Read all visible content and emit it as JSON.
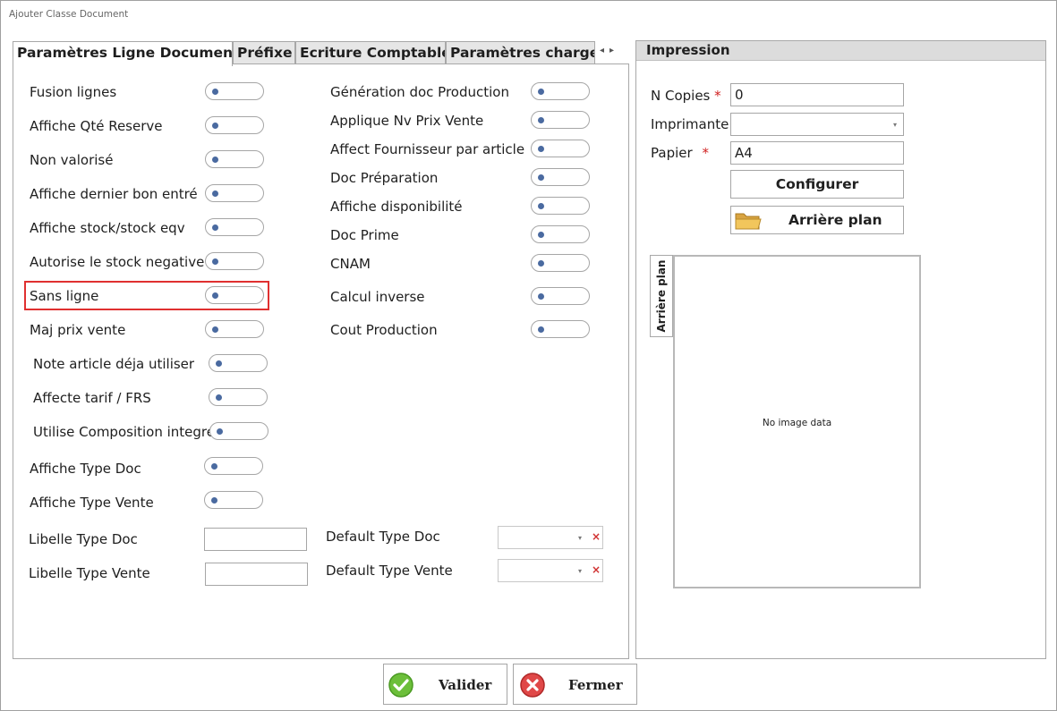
{
  "window": {
    "title": "Ajouter Classe Document"
  },
  "tabs": [
    {
      "label": "Paramètres Ligne Document"
    },
    {
      "label": "Préfixe"
    },
    {
      "label": "Ecriture Comptable"
    },
    {
      "label": "Paramètres charge"
    }
  ],
  "tab_nav": {
    "prev": "◂",
    "next": "▸"
  },
  "left_toggles": [
    {
      "label": "Fusion lignes"
    },
    {
      "label": "Affiche Qté Reserve"
    },
    {
      "label": "Non valorisé"
    },
    {
      "label": "Affiche dernier bon entré"
    },
    {
      "label": "Affiche stock/stock eqv"
    },
    {
      "label": "Autorise le stock negative"
    },
    {
      "label": "Sans ligne"
    },
    {
      "label": "Maj prix vente"
    },
    {
      "label": "Note article déja utiliser"
    },
    {
      "label": "Affecte tarif / FRS"
    },
    {
      "label": "Utilise Composition integré"
    },
    {
      "label": "Affiche Type Doc"
    },
    {
      "label": "Affiche Type Vente"
    }
  ],
  "right_toggles": [
    {
      "label": "Génération doc Production"
    },
    {
      "label": "Applique Nv Prix Vente"
    },
    {
      "label": "Affect Fournisseur par article"
    },
    {
      "label": "Doc Préparation"
    },
    {
      "label": "Affiche disponibilité"
    },
    {
      "label": "Doc Prime"
    },
    {
      "label": "CNAM"
    },
    {
      "label": "Calcul inverse"
    },
    {
      "label": "Cout Production"
    }
  ],
  "fields": {
    "libelle_type_doc": {
      "label": "Libelle Type Doc",
      "value": ""
    },
    "libelle_type_vente": {
      "label": "Libelle Type Vente",
      "value": ""
    },
    "default_type_doc": {
      "label": "Default Type Doc",
      "value": ""
    },
    "default_type_vente": {
      "label": "Default Type Vente",
      "value": ""
    }
  },
  "impression": {
    "title": "Impression",
    "n_copies": {
      "label": "N Copies",
      "required_mark": "*",
      "value": "0"
    },
    "imprimante": {
      "label": "Imprimante",
      "value": ""
    },
    "papier": {
      "label": "Papier",
      "required_mark": "*",
      "value": "A4"
    },
    "configurer_label": "Configurer",
    "arriere_plan_label": "Arrière plan",
    "preview_tab_label": "Arrière plan",
    "preview_text": "No image data"
  },
  "footer": {
    "valider_label": "Valider",
    "fermer_label": "Fermer"
  },
  "colors": {
    "highlight": "#e03030",
    "required": "#d02020",
    "toggle_knob": "#4a6aa0"
  }
}
